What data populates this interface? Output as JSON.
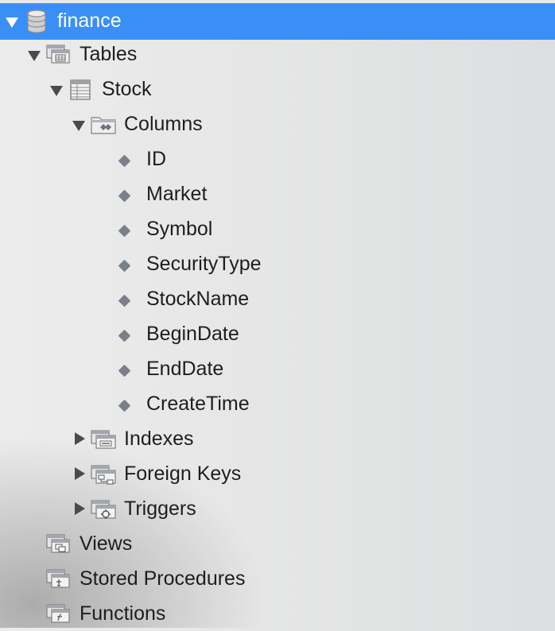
{
  "tree": {
    "database": {
      "label": "finance",
      "expanded": true,
      "icon": "database-icon"
    },
    "tables_group": {
      "label": "Tables",
      "expanded": true,
      "icon": "folder-icon"
    },
    "table": {
      "label": "Stock",
      "expanded": true,
      "icon": "table-icon"
    },
    "columns_group": {
      "label": "Columns",
      "expanded": true,
      "icon": "columns-folder-icon"
    },
    "columns": [
      {
        "label": "ID"
      },
      {
        "label": "Market"
      },
      {
        "label": "Symbol"
      },
      {
        "label": "SecurityType"
      },
      {
        "label": "StockName"
      },
      {
        "label": "BeginDate"
      },
      {
        "label": "EndDate"
      },
      {
        "label": "CreateTime"
      }
    ],
    "table_children": [
      {
        "label": "Indexes",
        "expanded": false,
        "icon": "indexes-folder-icon"
      },
      {
        "label": "Foreign Keys",
        "expanded": false,
        "icon": "foreign-keys-folder-icon"
      },
      {
        "label": "Triggers",
        "expanded": false,
        "icon": "triggers-folder-icon"
      }
    ],
    "groups": [
      {
        "label": "Views",
        "icon": "views-folder-icon"
      },
      {
        "label": "Stored Procedures",
        "icon": "procedures-folder-icon"
      },
      {
        "label": "Functions",
        "icon": "functions-folder-icon"
      }
    ]
  },
  "colors": {
    "selection": "#3a8ff7",
    "text": "#1e1e1e",
    "selected_text": "#ffffff",
    "column_marker": "#7b8088"
  }
}
